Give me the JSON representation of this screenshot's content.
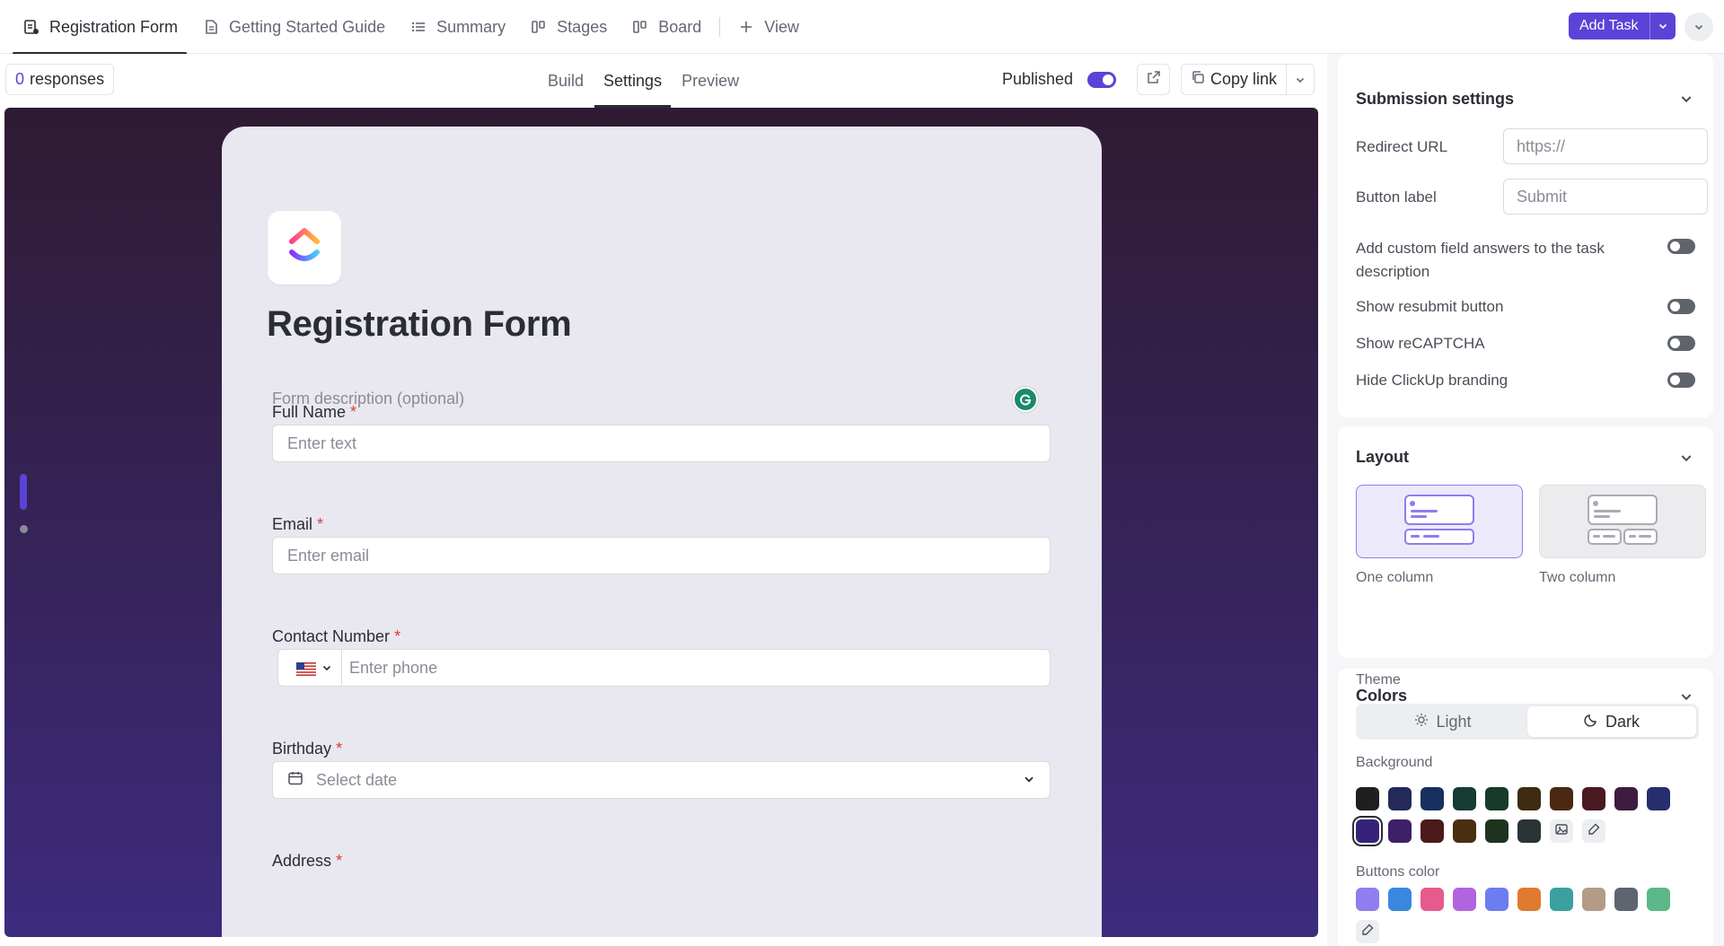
{
  "topbar": {
    "tabs": [
      {
        "label": "Registration Form",
        "icon": "form-icon",
        "active": true
      },
      {
        "label": "Getting Started Guide",
        "icon": "doc-icon",
        "active": false
      },
      {
        "label": "Summary",
        "icon": "list-icon",
        "active": false
      },
      {
        "label": "Stages",
        "icon": "stages-icon",
        "active": false
      },
      {
        "label": "Board",
        "icon": "board-icon",
        "active": false
      }
    ],
    "add_view_label": "View",
    "add_task_label": "Add Task"
  },
  "subbar": {
    "responses_count": "0",
    "responses_label": "responses",
    "modes": [
      "Build",
      "Settings",
      "Preview"
    ],
    "active_mode": "Settings",
    "published_label": "Published",
    "copy_link_label": "Copy link"
  },
  "form": {
    "title": "Registration Form",
    "description_placeholder": "Form description (optional)",
    "fields": [
      {
        "label": "Full Name",
        "placeholder": "Enter text",
        "required": true
      },
      {
        "label": "Email",
        "placeholder": "Enter email",
        "required": true
      },
      {
        "label": "Contact Number",
        "placeholder": "Enter phone",
        "required": true
      },
      {
        "label": "Birthday",
        "placeholder": "Select date",
        "required": true
      },
      {
        "label": "Address",
        "placeholder": "",
        "required": true
      }
    ],
    "required_mark": "*"
  },
  "panel": {
    "submission": {
      "title": "Submission settings",
      "redirect_label": "Redirect URL",
      "redirect_placeholder": "https://",
      "button_label_label": "Button label",
      "button_label_placeholder": "Submit",
      "toggles": [
        {
          "line1": "Add custom field answers to the task",
          "line2": "description",
          "on": false
        },
        {
          "line1": "Show resubmit button",
          "on": false
        },
        {
          "line1": "Show reCAPTCHA",
          "on": false
        },
        {
          "line1": "Hide ClickUp branding",
          "on": false
        }
      ]
    },
    "layout": {
      "title": "Layout",
      "options": [
        "One column",
        "Two column"
      ],
      "selected": "One column"
    },
    "colors": {
      "title": "Colors",
      "theme_label": "Theme",
      "theme_options": [
        "Light",
        "Dark"
      ],
      "theme_selected": "Dark",
      "background_label": "Background",
      "background_swatches": [
        "#1f1f22",
        "#232a5a",
        "#17305e",
        "#163b33",
        "#173a2a",
        "#3d2c12",
        "#4a2812",
        "#4a1a22",
        "#3d1c3f",
        "#262e6e",
        "#362278",
        "#3e2068",
        "#4a1a1a",
        "#4a2e10",
        "#1e3320",
        "#2a3336"
      ],
      "background_selected_index": 10,
      "buttons_label": "Buttons color",
      "button_swatches": [
        "#8f7df2",
        "#3a87e0",
        "#e65a8c",
        "#b264e0",
        "#6b7df0",
        "#e07a2e",
        "#3aa0a0",
        "#b39b86",
        "#5f6470",
        "#5cb887"
      ]
    }
  },
  "colors": {
    "accent": "#5a43d6",
    "required": "#d63d3d"
  }
}
